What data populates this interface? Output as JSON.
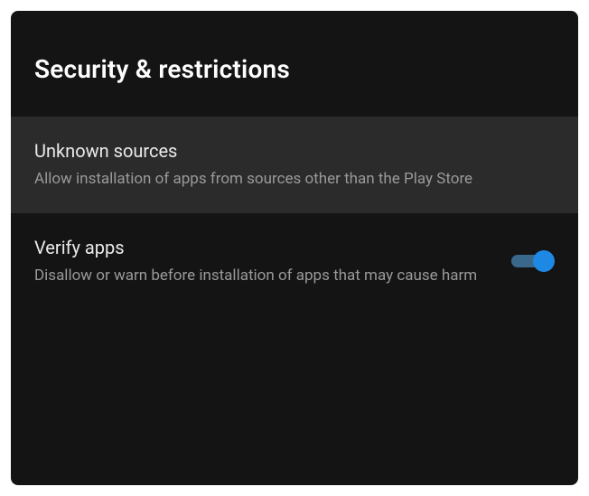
{
  "header": {
    "title": "Security & restrictions"
  },
  "settings": {
    "unknown_sources": {
      "title": "Unknown sources",
      "description": "Allow installation of apps from sources other than the Play Store"
    },
    "verify_apps": {
      "title": "Verify apps",
      "description": "Disallow or warn before installation of apps that may cause harm",
      "enabled": true
    }
  },
  "colors": {
    "bg": "#141414",
    "row_selected": "#2b2b2b",
    "text_primary": "#eaeaea",
    "text_secondary": "#9a9a9a",
    "accent": "#1e88e5"
  }
}
